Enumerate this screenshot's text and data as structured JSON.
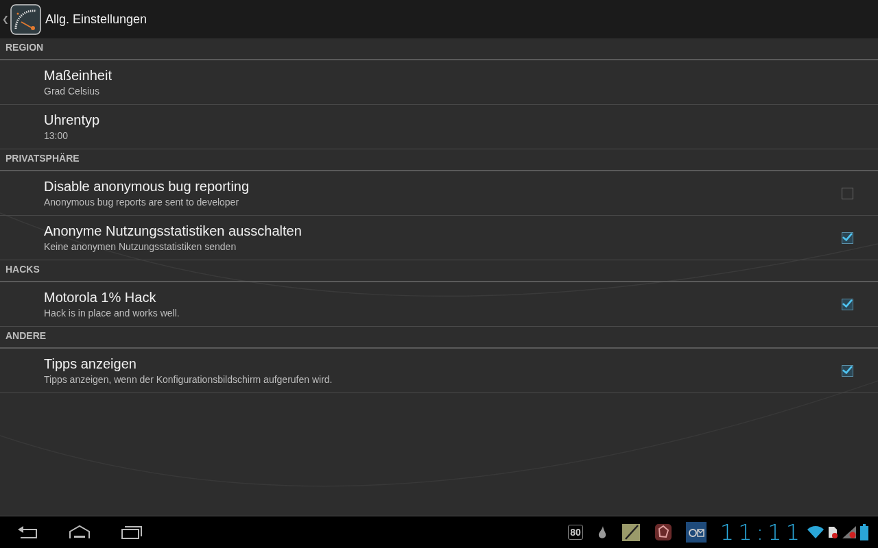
{
  "action_bar": {
    "back": "❮",
    "title": "Allg. Einstellungen"
  },
  "sections": [
    {
      "heading": "REGION",
      "items": [
        {
          "kind": "plain",
          "title": "Maßeinheit",
          "summary": "Grad Celsius"
        },
        {
          "kind": "plain",
          "title": "Uhrentyp",
          "summary": "13:00"
        }
      ]
    },
    {
      "heading": "PRIVATSPHÄRE",
      "items": [
        {
          "kind": "checkbox",
          "title": "Disable anonymous bug reporting",
          "summary": "Anonymous bug reports are sent to developer",
          "checked": false
        },
        {
          "kind": "checkbox",
          "title": "Anonyme Nutzungsstatistiken ausschalten",
          "summary": "Keine anonymen Nutzungsstatistiken senden",
          "checked": true
        }
      ]
    },
    {
      "heading": "HACKS",
      "items": [
        {
          "kind": "checkbox",
          "title": "Motorola 1% Hack",
          "summary": "Hack is in place and works well.",
          "checked": true
        }
      ]
    },
    {
      "heading": "ANDERE",
      "items": [
        {
          "kind": "checkbox",
          "title": "Tipps anzeigen",
          "summary": "Tipps anzeigen, wenn der Konfigurationsbildschirm aufgerufen wird.",
          "checked": true
        }
      ]
    }
  ],
  "system_bar": {
    "notification_badge": "80",
    "clock": "11:11"
  }
}
